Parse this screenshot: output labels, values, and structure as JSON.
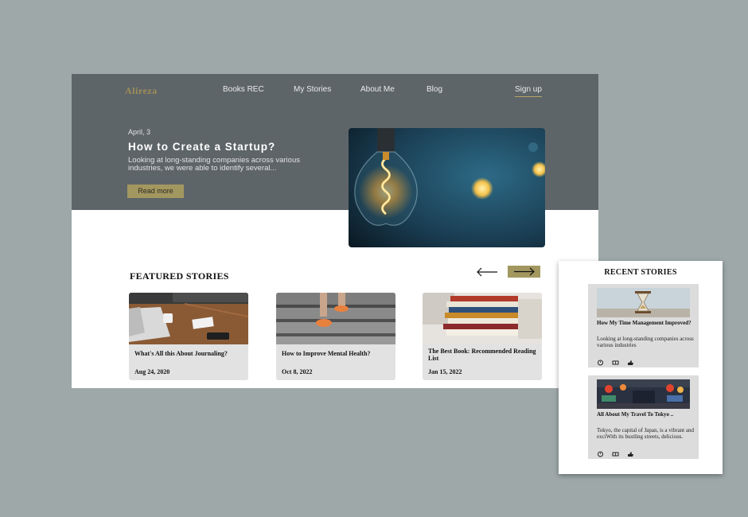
{
  "brand": {
    "logo": "Alireza"
  },
  "nav": {
    "items": [
      "Books REC",
      "My Stories",
      "About Me",
      "Blog"
    ],
    "signup": "Sign up"
  },
  "hero": {
    "date": "April, 3",
    "title": "How to Create a Startup?",
    "excerpt": "Looking at long-standing companies across various industries, we were able to identify several...",
    "cta": "Read more",
    "image_icon": "light-bulb-photo"
  },
  "featured": {
    "heading": "FEATURED STORIES",
    "cards": [
      {
        "title": "What's All this About Journaling?",
        "date": "Aug 24, 2020",
        "image_icon": "laptop-desk-photo"
      },
      {
        "title": "How to Improve Mental Health?",
        "date": "Oct 8, 2022",
        "image_icon": "stairs-runner-photo"
      },
      {
        "title": "The Best Book: Recommended Reading List",
        "date": "Jan 15, 2022",
        "image_icon": "book-stack-photo"
      }
    ]
  },
  "recent": {
    "heading": "RECENT STORIES",
    "items": [
      {
        "title": "How My Time Management Improved?",
        "excerpt": "Looking at long-standing companies across various industries",
        "image_icon": "hourglass-photo"
      },
      {
        "title": "All About My Travel To Tokyo ..",
        "excerpt": "Tokyo, the capital of Japan, is a vibrant and exciWith its bustling streets, delicious.",
        "image_icon": "tokyo-street-photo"
      }
    ]
  },
  "colors": {
    "accent": "#a39760",
    "hero_bg": "#5e6569",
    "page_bg": "#9ea8a9",
    "card_bg": "#e2e2e2"
  }
}
